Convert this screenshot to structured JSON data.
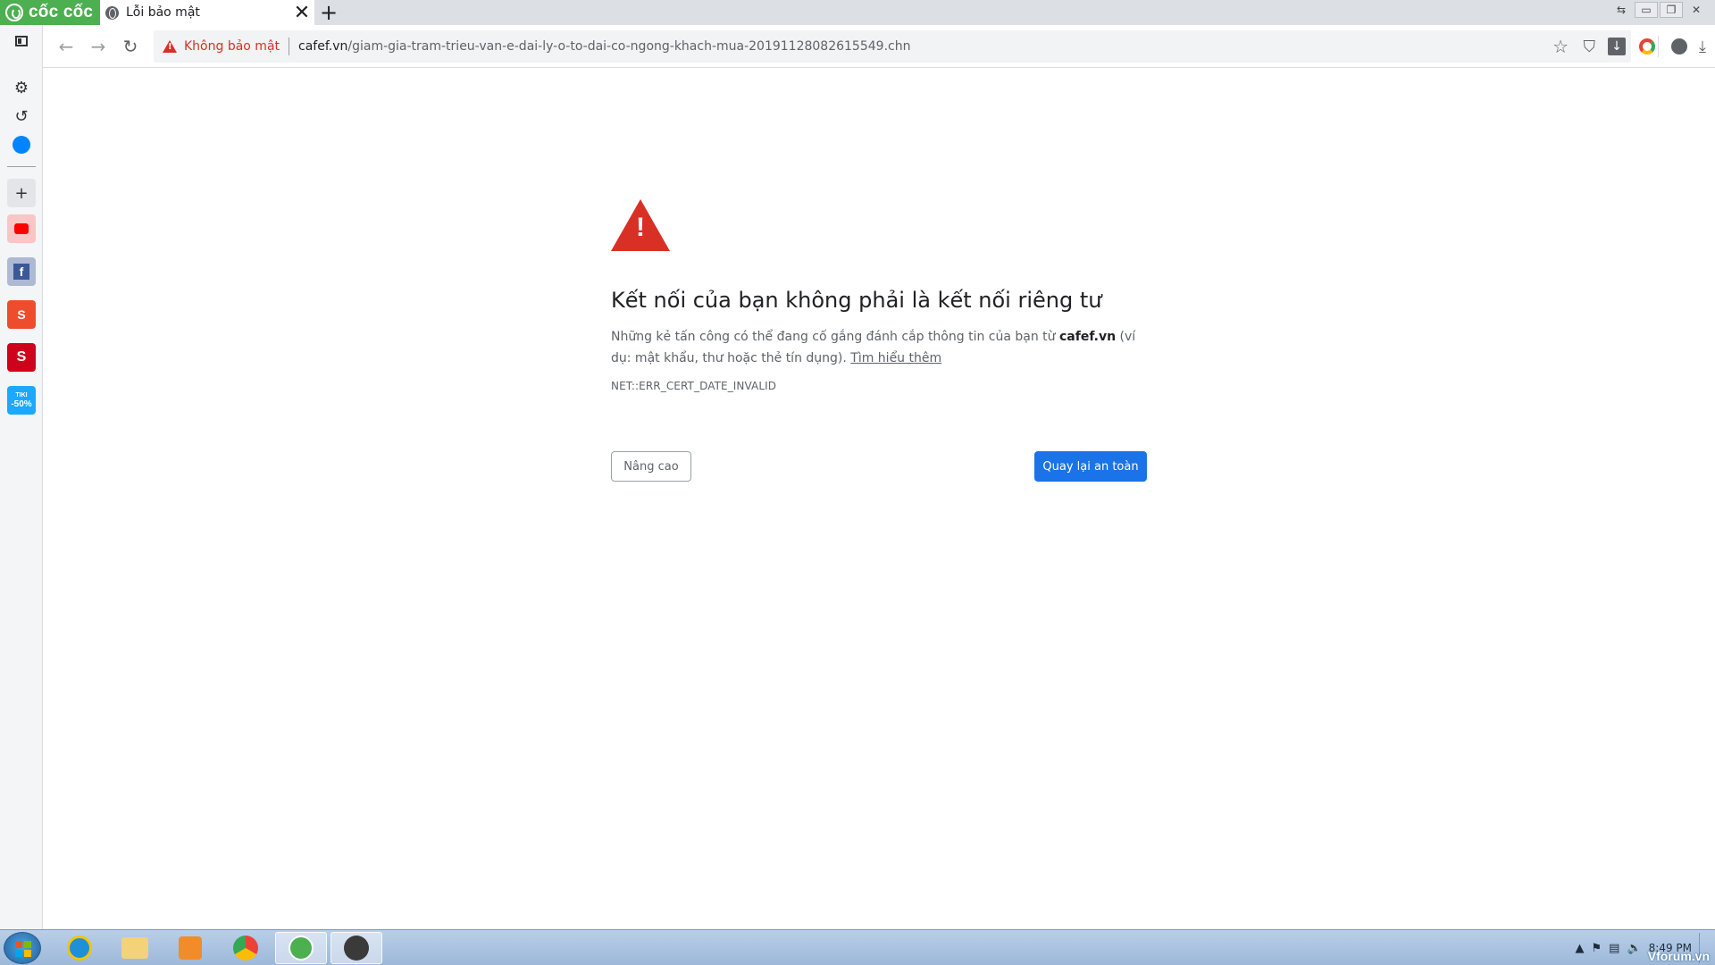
{
  "browser": {
    "brand": "cốc cốc",
    "tab_title": "Lỗi bảo mật",
    "new_tab": "+",
    "tab_close": "✕"
  },
  "omnibox": {
    "security_label": "Không bảo mật",
    "url_domain": "cafef.vn",
    "url_path": "/giam-gia-tram-trieu-van-e-dai-ly-o-to-dai-co-ngong-khach-mua-20191128082615549.chn"
  },
  "icons": {
    "back": "arrow-left",
    "forward": "arrow-right",
    "reload": "reload",
    "bookmark": "star",
    "shield": "shield",
    "download": "download",
    "account": "user",
    "menu_download": "download-arrow"
  },
  "sidebar": {
    "items": [
      {
        "name": "sidebar-toggle",
        "icon": "panel"
      },
      {
        "name": "settings",
        "icon": "gear"
      },
      {
        "name": "history",
        "icon": "history"
      },
      {
        "name": "messenger",
        "icon": "messenger"
      },
      {
        "name": "add",
        "icon": "plus"
      },
      {
        "name": "youtube",
        "icon": "youtube"
      },
      {
        "name": "facebook",
        "icon": "facebook"
      },
      {
        "name": "shopee",
        "icon": "shopee"
      },
      {
        "name": "sendo",
        "icon": "sendo"
      },
      {
        "name": "tiki",
        "icon": "tiki",
        "label": "-50%",
        "sublabel": "TIKI"
      }
    ]
  },
  "error_page": {
    "heading": "Kết nối của bạn không phải là kết nối riêng tư",
    "desc_before": "Những kẻ tấn công có thể đang cố gắng đánh cắp thông tin của bạn từ ",
    "desc_domain": "cafef.vn",
    "desc_after": " (ví dụ: mật khẩu, thư hoặc thẻ tín dụng). ",
    "learn_more": "Tìm hiểu thêm",
    "error_code": "NET::ERR_CERT_DATE_INVALID",
    "advanced_button": "Nâng cao",
    "back_button": "Quay lại an toàn"
  },
  "taskbar": {
    "clock_time": "8:49 PM",
    "watermark": "Vforum.vn"
  },
  "colors": {
    "error_red": "#d93025",
    "primary_blue": "#1a73e8",
    "brand_green": "#4caf50"
  }
}
